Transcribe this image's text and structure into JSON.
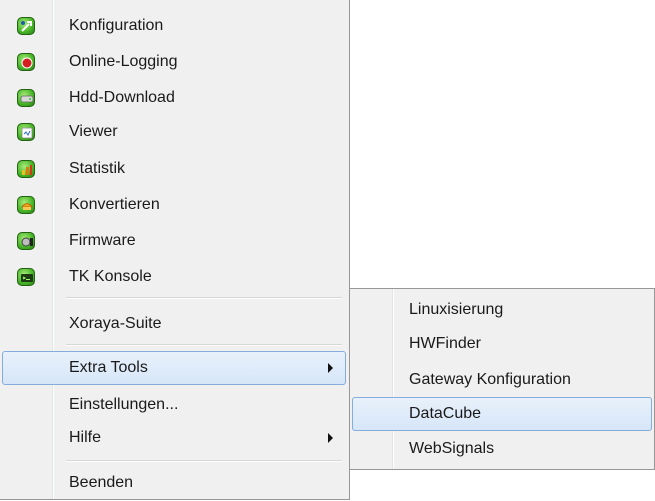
{
  "menu": {
    "items": [
      {
        "label": "Konfiguration",
        "icon": "konfiguration-icon"
      },
      {
        "label": "Online-Logging",
        "icon": "online-logging-icon"
      },
      {
        "label": "Hdd-Download",
        "icon": "hdd-download-icon"
      },
      {
        "label": "Viewer",
        "icon": "viewer-icon"
      },
      {
        "label": "Statistik",
        "icon": "statistik-icon"
      },
      {
        "label": "Konvertieren",
        "icon": "konvertieren-icon"
      },
      {
        "label": "Firmware",
        "icon": "firmware-icon"
      },
      {
        "label": "TK Konsole",
        "icon": "tk-konsole-icon"
      },
      {
        "label": "Xoraya-Suite"
      },
      {
        "label": "Extra Tools",
        "selected": true,
        "has_submenu": true
      },
      {
        "label": "Einstellungen..."
      },
      {
        "label": "Hilfe",
        "has_submenu": true
      },
      {
        "label": "Beenden"
      }
    ]
  },
  "submenu": {
    "items": [
      {
        "label": "Linuxisierung"
      },
      {
        "label": "HWFinder"
      },
      {
        "label": "Gateway Konfiguration"
      },
      {
        "label": "DataCube",
        "selected": true
      },
      {
        "label": "WebSignals"
      }
    ]
  },
  "colors": {
    "menu_background": "#f0f0f0",
    "highlight_fill": "#d9e8f9",
    "highlight_border": "#84acdd",
    "icon_green": "#46b427"
  }
}
